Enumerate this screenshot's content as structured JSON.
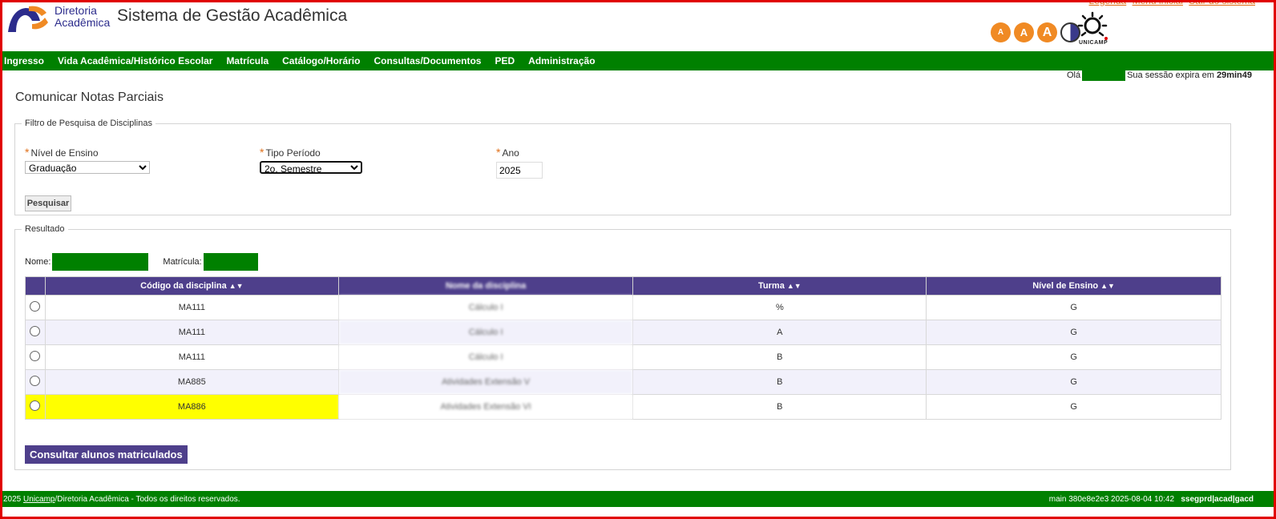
{
  "header": {
    "brand_line1": "Diretoria",
    "brand_line2": "Acadêmica",
    "system_title": "Sistema de Gestão Acadêmica",
    "links": [
      "Legenda",
      "Menu inicial",
      "Sair do sistema"
    ],
    "accessibility": [
      "A",
      "A",
      "A"
    ],
    "unicamp_label": "UNICAMP"
  },
  "nav": {
    "items": [
      "Ingresso",
      "Vida Acadêmica/Histórico Escolar",
      "Matrícula",
      "Catálogo/Horário",
      "Consultas/Documentos",
      "PED",
      "Administração"
    ]
  },
  "session": {
    "greeting": "Olá",
    "expires_prefix": "Sua sessão expira em",
    "expires_time": "29min49"
  },
  "page": {
    "title": "Comunicar Notas Parciais"
  },
  "filter": {
    "legend": "Filtro de Pesquisa de Disciplinas",
    "nivel_label": "Nível de Ensino",
    "nivel_value": "Graduação",
    "periodo_label": "Tipo Período",
    "periodo_value": "2o. Semestre",
    "ano_label": "Ano",
    "ano_value": "2025",
    "search_button": "Pesquisar"
  },
  "result": {
    "legend": "Resultado",
    "nome_label": "Nome:",
    "matricula_label": "Matrícula:",
    "columns": [
      "Código da disciplina",
      "Nome da disciplina",
      "Turma",
      "Nível de Ensino"
    ],
    "rows": [
      {
        "codigo": "MA111",
        "nome": "Cálculo I",
        "turma": "%",
        "nivel": "G"
      },
      {
        "codigo": "MA111",
        "nome": "Cálculo I",
        "turma": "A",
        "nivel": "G"
      },
      {
        "codigo": "MA111",
        "nome": "Cálculo I",
        "turma": "B",
        "nivel": "G"
      },
      {
        "codigo": "MA885",
        "nome": "Atividades Extensão V",
        "turma": "B",
        "nivel": "G"
      },
      {
        "codigo": "MA886",
        "nome": "Atividades Extensão VI",
        "turma": "B",
        "nivel": "G"
      }
    ],
    "consult_button": "Consultar alunos matriculados"
  },
  "footer": {
    "year": "2025",
    "org": "Unicamp",
    "rest": "/Diretoria Acadêmica - Todos os direitos reservados.",
    "build": "main 380e8e2e3 2025-08-04 10:42",
    "server": "ssegprd|acad|gacd"
  },
  "colors": {
    "nav_green": "#008000",
    "table_header": "#4e3f8b",
    "accent_orange": "#f08a24",
    "highlight": "#ffff00"
  }
}
